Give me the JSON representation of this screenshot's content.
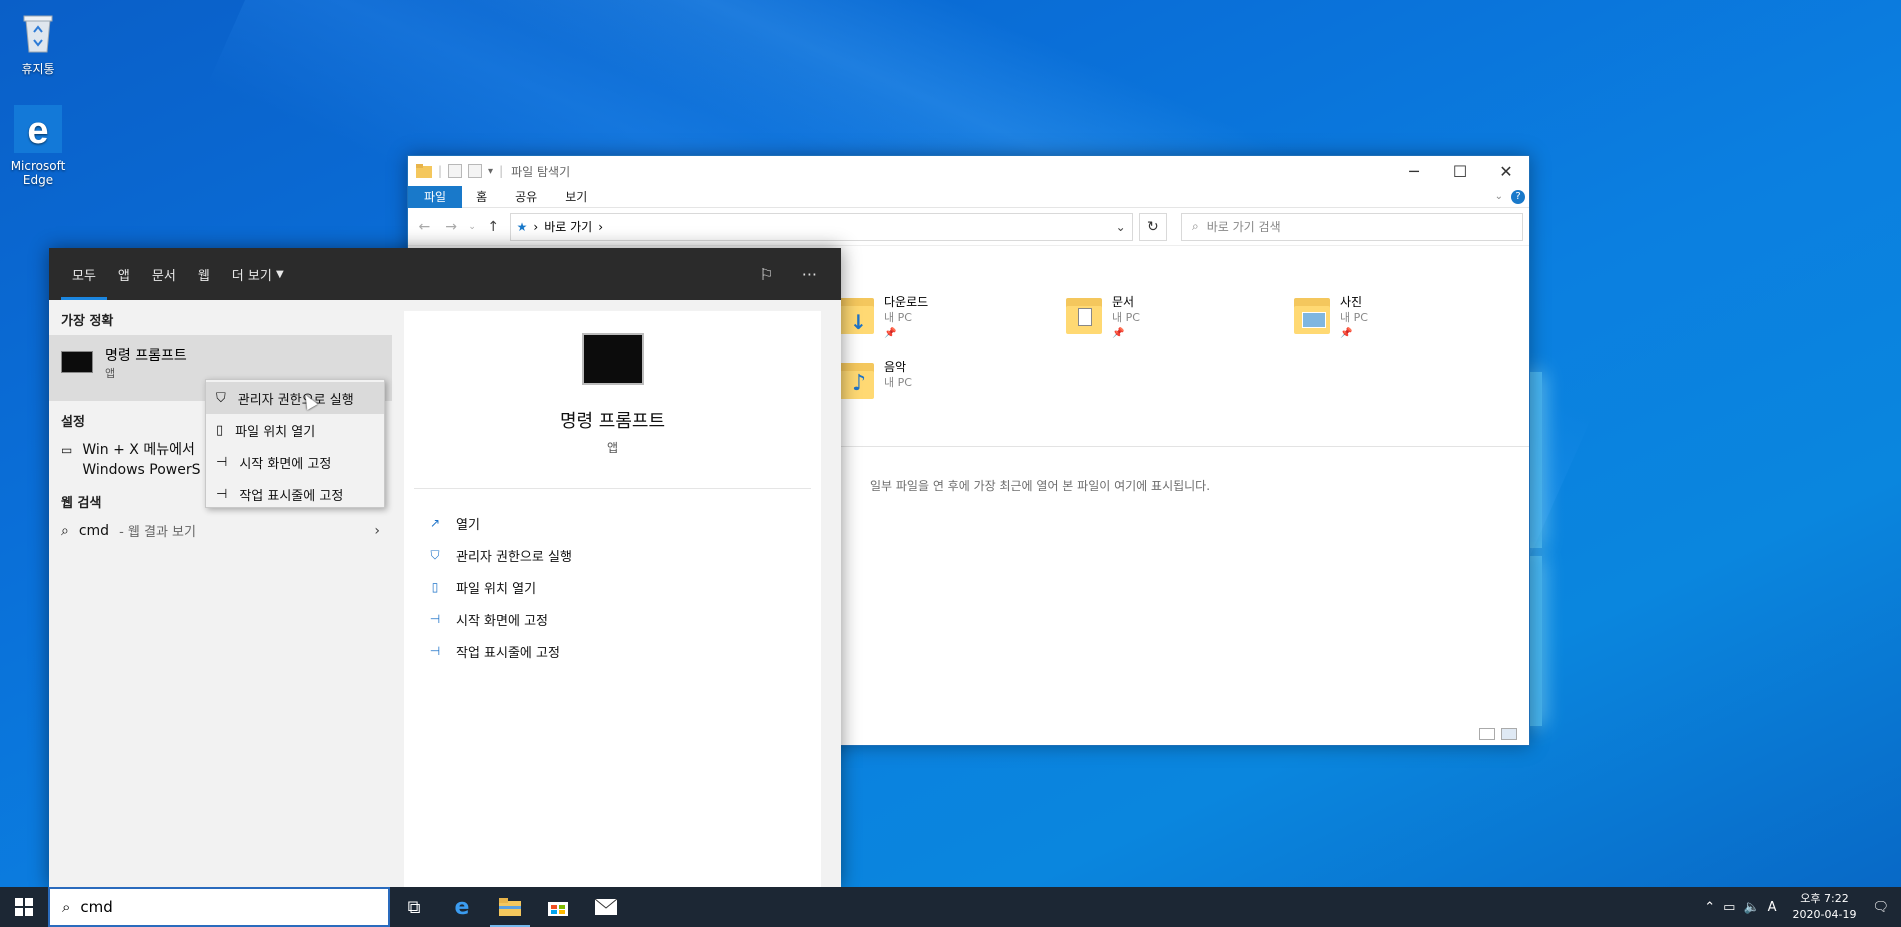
{
  "desktop": {
    "icons": [
      {
        "label": "휴지통",
        "icon": "recycle-bin-icon"
      },
      {
        "label": "Microsoft Edge",
        "icon": "edge-icon"
      }
    ]
  },
  "explorer": {
    "title": "파일 탐색기",
    "ribbon_tabs": [
      "파일",
      "홈",
      "공유",
      "보기"
    ],
    "breadcrumb": "바로 가기",
    "search_placeholder": "바로 가기 검색",
    "folders": [
      {
        "name": "다운로드",
        "location": "내 PC"
      },
      {
        "name": "문서",
        "location": "내 PC"
      },
      {
        "name": "사진",
        "location": "내 PC"
      },
      {
        "name": "음악",
        "location": "내 PC"
      }
    ],
    "recent_message": "일부 파일을 연 후에 가장 최근에 열어 본 파일이 여기에 표시됩니다."
  },
  "start_search": {
    "tabs": [
      "모두",
      "앱",
      "문서",
      "웹",
      "더 보기"
    ],
    "best_match_header": "가장 정확",
    "best_match": {
      "title": "명령 프롬프트",
      "subtitle": "앱"
    },
    "settings_header": "설정",
    "settings_item": {
      "line1": "Win + X 메뉴에서",
      "line2": "Windows PowerS"
    },
    "web_header": "웹 검색",
    "web_item": {
      "query": "cmd",
      "suffix": "- 웹 결과 보기"
    },
    "detail": {
      "title": "명령 프롬프트",
      "subtitle": "앱",
      "actions": [
        "열기",
        "관리자 권한으로 실행",
        "파일 위치 열기",
        "시작 화면에 고정",
        "작업 표시줄에 고정"
      ]
    },
    "context_menu": [
      "관리자 권한으로 실행",
      "파일 위치 열기",
      "시작 화면에 고정",
      "작업 표시줄에 고정"
    ]
  },
  "taskbar": {
    "search_value": "cmd",
    "clock_time": "오후 7:22",
    "clock_date": "2020-04-19",
    "ime_indicator": "A"
  },
  "colors": {
    "accent": "#1979ca",
    "taskbar": "#1c2734",
    "tab_underline": "#1b86e0"
  }
}
